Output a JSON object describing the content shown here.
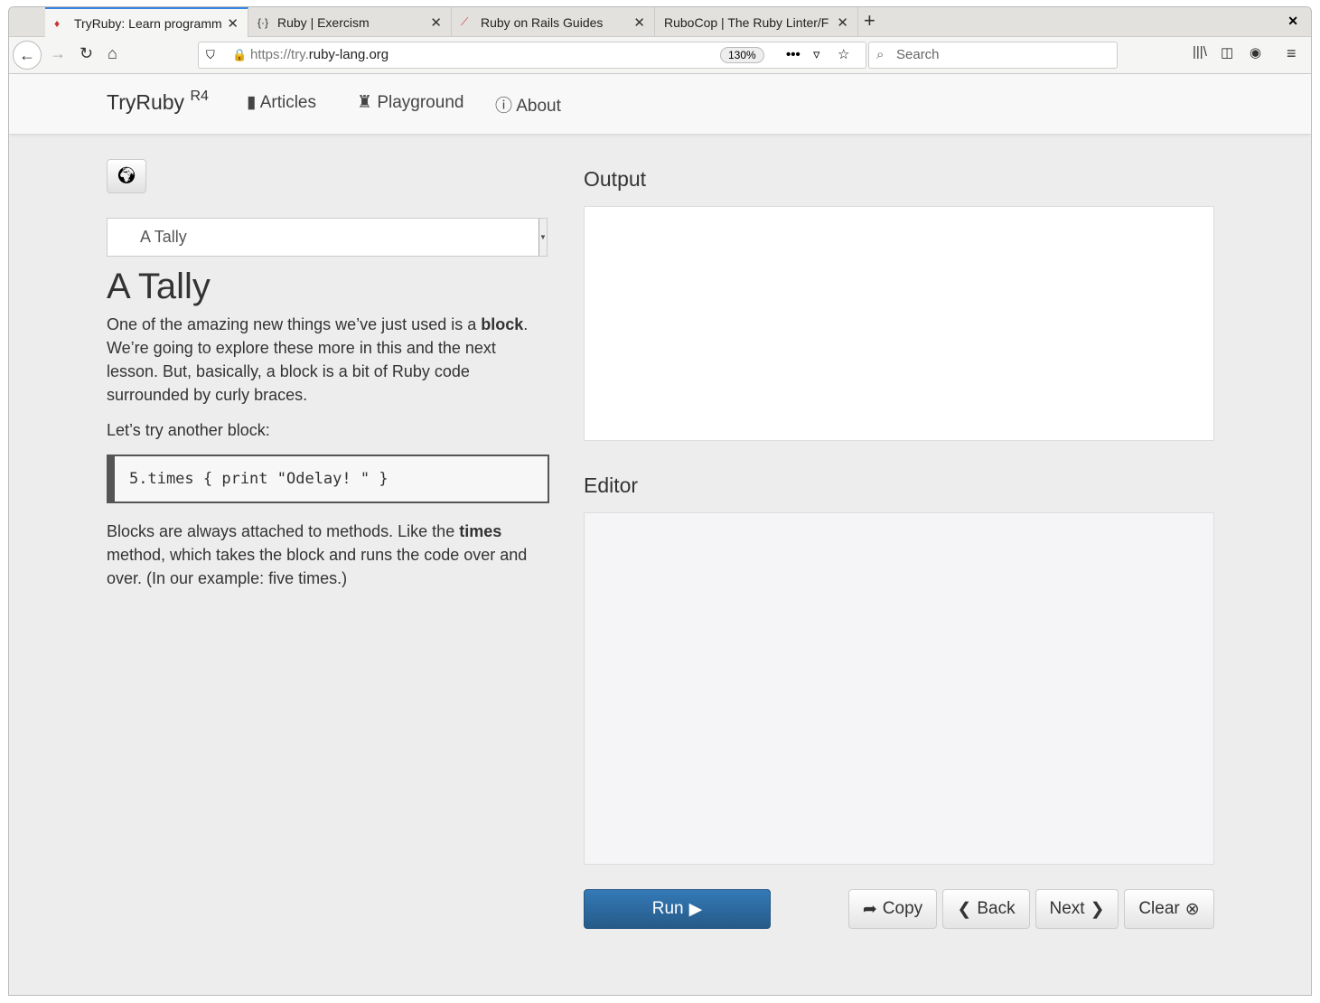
{
  "browser": {
    "tabs": [
      {
        "title": "TryRuby: Learn programm",
        "icon": "ruby-icon"
      },
      {
        "title": "Ruby | Exercism",
        "icon": "exercism-icon"
      },
      {
        "title": "Ruby on Rails Guides",
        "icon": "rails-icon"
      },
      {
        "title": "RuboCop | The Ruby Linter/F",
        "icon": "rubocop-icon"
      }
    ],
    "url_prefix": "https://try.",
    "url_domain": "ruby-lang.org",
    "zoom": "130%",
    "search_placeholder": "Search"
  },
  "nav": {
    "brand": "TryRuby",
    "version": "R4",
    "articles": "Articles",
    "playground": "Playground",
    "about": "About"
  },
  "lesson": {
    "select_value": "A Tally",
    "title": "A Tally",
    "p1_a": "One of the amazing new things we’ve just used is a ",
    "p1_b": "block",
    "p1_c": ". We’re going to explore these more in this and the next lesson. But, basically, a block is a bit of Ruby code surrounded by curly braces.",
    "p2": "Let’s try another block:",
    "code": "5.times { print \"Odelay! \" }",
    "p3_a": "Blocks are always attached to methods. Like the ",
    "p3_b": "times",
    "p3_c": " method, which takes the block and runs the code over and over. (In our example: five times.)"
  },
  "output_label": "Output",
  "editor_label": "Editor",
  "buttons": {
    "run": "Run",
    "copy": "Copy",
    "back": "Back",
    "next": "Next",
    "clear": "Clear"
  }
}
